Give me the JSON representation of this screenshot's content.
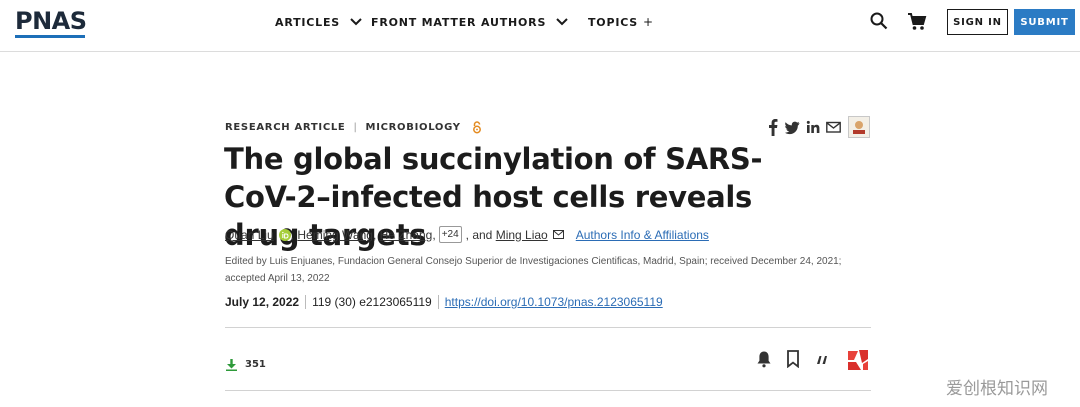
{
  "header": {
    "logo": "PNAS",
    "nav": {
      "articles": "ARTICLES",
      "front_matter": "FRONT MATTER",
      "authors": "AUTHORS",
      "topics": "TOPICS",
      "topics_suffix": "+"
    },
    "sign_in": "SIGN IN",
    "submit": "SUBMIT",
    "icons": [
      "search-icon",
      "cart-icon",
      "chevron-down-icon"
    ],
    "colors": {
      "brand": "#1d6fb8",
      "submit_bg": "#2b7bc4",
      "link": "#2b6cb5"
    }
  },
  "article": {
    "type": "RESEARCH ARTICLE",
    "separator": "|",
    "subject": "MICROBIOLOGY",
    "title": "The global succinylation of SARS-CoV-2–infected host cells reveals drug targets",
    "authors": {
      "a1": "Quan Liu",
      "a2": "Heming Wang",
      "a3": "He Zhang",
      "more": "+24",
      "and_text": ", and",
      "last": "Ming Liao",
      "affiliations_link": "Authors Info & Affiliations"
    },
    "edited_by": "Edited by Luis Enjuanes, Fundacion General Consejo Superior de Investigaciones Cientificas, Madrid, Spain; received December 24, 2021; accepted April 13, 2022",
    "pub_date": "July 12, 2022",
    "citation": "119 (30) e2123065119",
    "doi": "https://doi.org/10.1073/pnas.2123065119",
    "downloads": "351",
    "share_icons": [
      "facebook-icon",
      "twitter-icon",
      "linkedin-icon",
      "mail-icon"
    ],
    "action_icons": [
      "bell-icon",
      "bookmark-icon",
      "cite-icon",
      "altmetric-icon"
    ]
  },
  "watermark": "爱创根知识网"
}
